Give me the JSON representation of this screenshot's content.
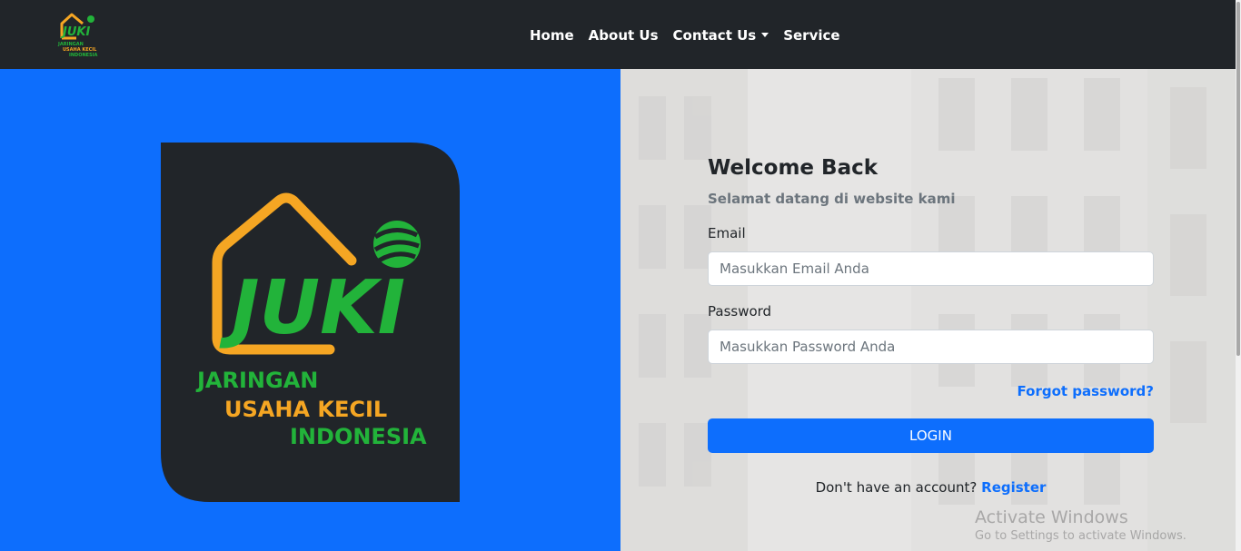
{
  "navbar": {
    "links": [
      {
        "label": "Home"
      },
      {
        "label": "About Us"
      },
      {
        "label": "Contact Us"
      },
      {
        "label": "Service"
      }
    ]
  },
  "logo": {
    "title": "JUKI",
    "line1": "JARINGAN",
    "line2": "USAHA KECIL",
    "line3": "INDONESIA"
  },
  "login": {
    "heading": "Welcome Back",
    "subtitle": "Selamat datang di website kami",
    "email_label": "Email",
    "email_placeholder": "Masukkan Email Anda",
    "password_label": "Password",
    "password_placeholder": "Masukkan Password Anda",
    "forgot": "Forgot password?",
    "button": "LOGIN",
    "register_prompt": "Don't have an account?",
    "register_link": "Register"
  },
  "watermark": {
    "title": "Activate Windows",
    "subtitle": "Go to Settings to activate Windows."
  },
  "colors": {
    "primary": "#0d6efd",
    "dark": "#212529",
    "logo_orange": "#f5a623",
    "logo_green": "#22b33a"
  }
}
